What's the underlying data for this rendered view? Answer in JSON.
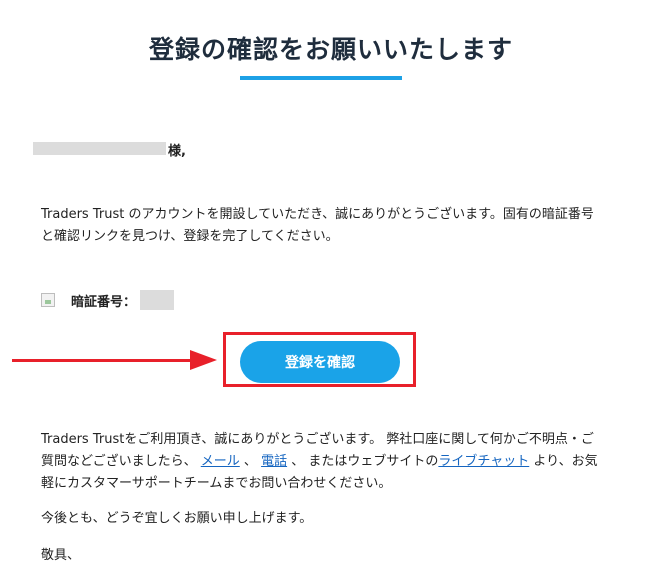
{
  "header": {
    "title": "登録の確認をお願いいたします"
  },
  "greeting": {
    "suffix": "様,"
  },
  "intro": {
    "text": "Traders Trust のアカウントを開設していただき、誠にありがとうございます。固有の暗証番号と確認リンクを見つけ、登録を完了してください。"
  },
  "pin": {
    "label": "暗証番号："
  },
  "cta": {
    "button_label": "登録を確認",
    "button_color": "#1aa3e8",
    "annotation_color": "#e8202a"
  },
  "support": {
    "text_before": "Traders Trustをご利用頂き、誠にありがとうございます。 弊社口座に関して何かご不明点・ご質問などございましたら、",
    "mail_link": "メール",
    "sep1": "、",
    "phone_link": "電話",
    "text_middle": "、 またはウェブサイトの",
    "chat_link": "ライブチャット",
    "text_after": "より、お気軽にカスタマーサポートチームまでお問い合わせください。"
  },
  "closing": {
    "text": "今後とも、どうぞ宜しくお願い申し上げます。"
  },
  "signoff": {
    "text": "敬具、"
  }
}
